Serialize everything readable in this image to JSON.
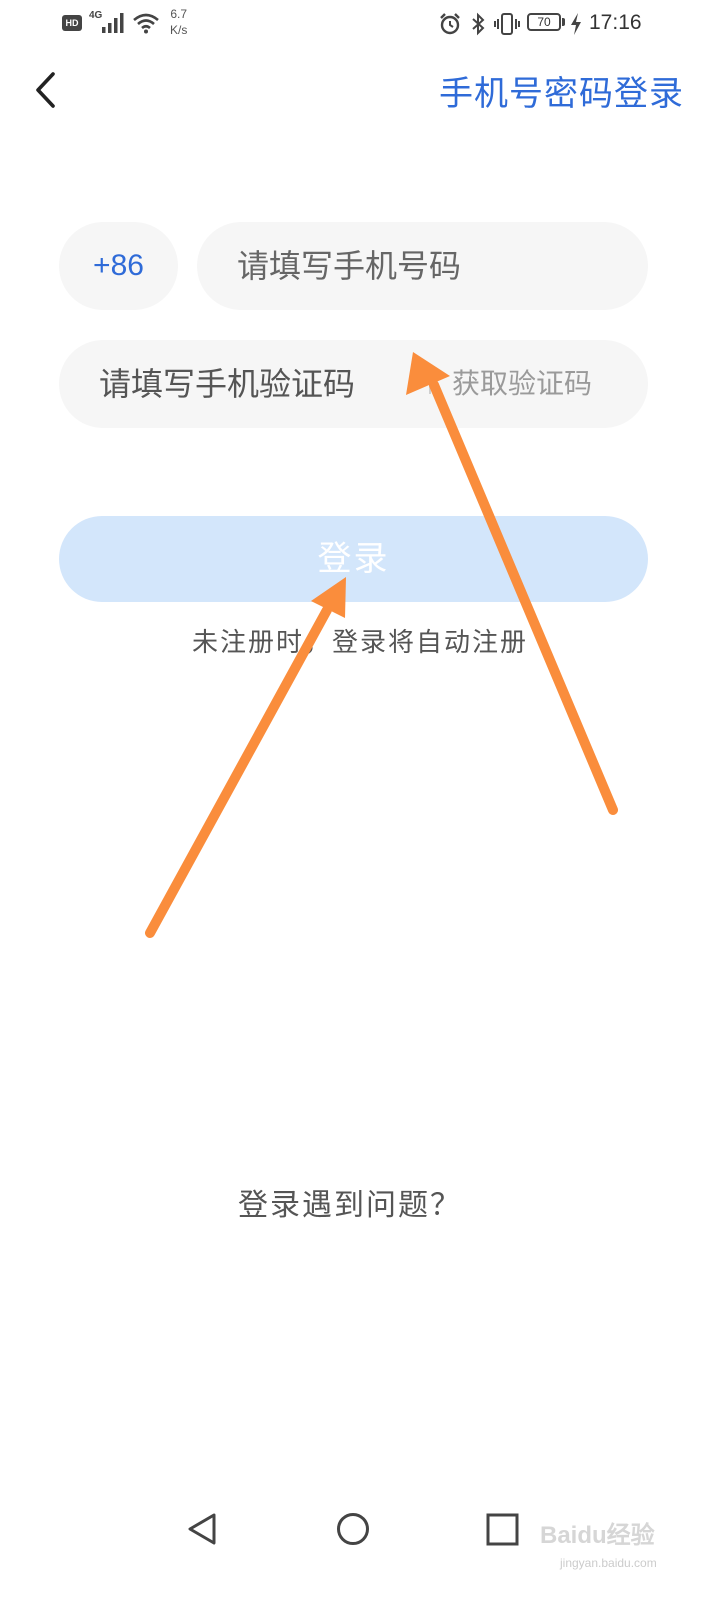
{
  "status_bar": {
    "hd": "HD",
    "network": "4G",
    "speed_value": "6.7",
    "speed_unit": "K/s",
    "battery": "70",
    "time": "17:16",
    "icons": [
      "signal-icon",
      "wifi-icon",
      "alarm-icon",
      "bluetooth-icon",
      "vibrate-icon",
      "battery-icon",
      "charging-icon"
    ]
  },
  "header": {
    "back_icon": "chevron-left-icon",
    "switch_link": "手机号密码登录",
    "accent_color": "#2f6bd8"
  },
  "form": {
    "country_code": "+86",
    "phone_placeholder": "请填写手机号码",
    "code_placeholder": "请填写手机验证码",
    "get_code_label": "获取验证码"
  },
  "login_button": {
    "label": "登录",
    "color": "#d3e6fb"
  },
  "auto_register_note": "未注册时，登录将自动注册",
  "help_link": "登录遇到问题？",
  "annotation": {
    "arrow_color": "#fa8d3c"
  },
  "nav_bar": {
    "icons": [
      "back-triangle-icon",
      "home-circle-icon",
      "recents-square-icon"
    ]
  },
  "watermark": {
    "text": "Baidu经验",
    "sub": "jingyan.baidu.com"
  }
}
